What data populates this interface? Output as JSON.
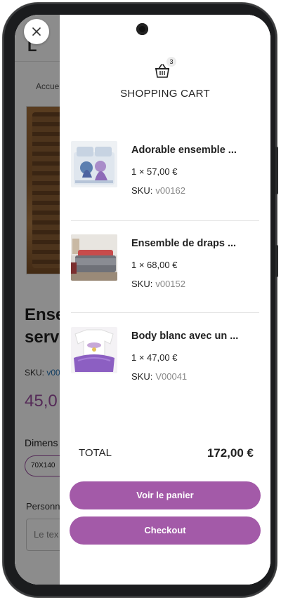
{
  "background_page": {
    "breadcrumb": "Accue",
    "product_title_line1": "Ense",
    "product_title_line2": "serv",
    "sku_label": "SKU:",
    "sku_value": "v00",
    "price": "45,0",
    "dimension_label": "Dimens",
    "dimension_chip": "70X140",
    "personalize_label": "Personn",
    "text_input_placeholder": "Le tex"
  },
  "cart": {
    "count": "3",
    "title": "SHOPPING CART",
    "items": [
      {
        "name": "Adorable ensemble ...",
        "qty_price": "1 × 57,00 €",
        "sku_label": "SKU:",
        "sku": "v00162",
        "thumb_icon": "bedding-product-thumbnail"
      },
      {
        "name": "Ensemble de draps ...",
        "qty_price": "1 × 68,00 €",
        "sku_label": "SKU:",
        "sku": "v00152",
        "thumb_icon": "bedroom-product-thumbnail"
      },
      {
        "name": "Body blanc avec un ...",
        "qty_price": "1 × 47,00 €",
        "sku_label": "SKU:",
        "sku": "V00041",
        "thumb_icon": "baby-body-product-thumbnail"
      }
    ],
    "total_label": "TOTAL",
    "total_value": "172,00 €",
    "view_cart_button": "Voir le panier",
    "checkout_button": "Checkout"
  },
  "colors": {
    "accent": "#a35aa8",
    "price": "#9b4fa0",
    "link": "#1f6fb2"
  }
}
